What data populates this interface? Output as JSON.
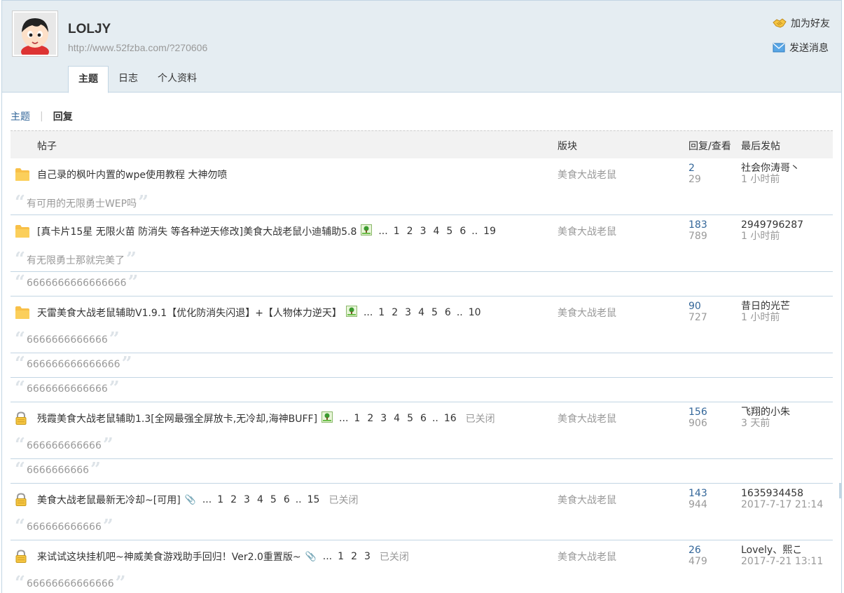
{
  "profile": {
    "username": "LOLJY",
    "url": "http://www.52fzba.com/?270606",
    "add_friend": "加为好友",
    "send_message": "发送消息"
  },
  "tabs": [
    {
      "label": "主题",
      "active": true
    },
    {
      "label": "日志",
      "active": false
    },
    {
      "label": "个人资料",
      "active": false
    }
  ],
  "subnav": {
    "topics": "主题",
    "replies": "回复"
  },
  "table_header": {
    "post": "帖子",
    "forum": "版块",
    "reply_view": "回复/查看",
    "last_post": "最后发帖"
  },
  "threads": [
    {
      "title": "自己录的枫叶内置的wpe使用教程 大神勿喷",
      "icon": "folder-icon",
      "has_image": false,
      "has_attachment": false,
      "pages": [],
      "closed": "",
      "forum": "美食大战老鼠",
      "replies": "2",
      "views": "29",
      "last_user": "社会你涛哥丶",
      "last_time": "1 小时前",
      "quotes": [
        "有可用的无限勇士WEP吗"
      ]
    },
    {
      "title": "[真卡片15星 无限火苗 防消失 等各种逆天修改]美食大战老鼠小迪辅助5.8",
      "icon": "folder-icon",
      "has_image": true,
      "has_attachment": false,
      "pages": [
        "...",
        "1",
        "2",
        "3",
        "4",
        "5",
        "6",
        "..",
        "19"
      ],
      "closed": "",
      "forum": "美食大战老鼠",
      "replies": "183",
      "views": "789",
      "last_user": "2949796287",
      "last_time": "1 小时前",
      "quotes": [
        "有无限勇士那就完美了",
        "6666666666666666"
      ]
    },
    {
      "title": "天雷美食大战老鼠辅助V1.9.1【优化防消失闪退】+【人物体力逆天】",
      "icon": "folder-icon",
      "has_image": true,
      "has_attachment": false,
      "pages": [
        "...",
        "1",
        "2",
        "3",
        "4",
        "5",
        "6",
        "..",
        "10"
      ],
      "closed": "",
      "forum": "美食大战老鼠",
      "replies": "90",
      "views": "727",
      "last_user": "昔日的光芒",
      "last_time": "1 小时前",
      "quotes": [
        "6666666666666",
        "666666666666666",
        "6666666666666"
      ]
    },
    {
      "title": "残霞美食大战老鼠辅助1.3[全网最强全屏放卡,无冷却,海神BUFF]",
      "icon": "lock-icon",
      "has_image": true,
      "has_attachment": false,
      "pages": [
        "...",
        "1",
        "2",
        "3",
        "4",
        "5",
        "6",
        "..",
        "16"
      ],
      "closed": "已关闭",
      "forum": "美食大战老鼠",
      "replies": "156",
      "views": "906",
      "last_user": "飞翔的小朱",
      "last_time": "3 天前",
      "quotes": [
        "666666666666",
        "6666666666"
      ]
    },
    {
      "title": "美食大战老鼠最新无冷却~[可用]",
      "icon": "lock-icon",
      "has_image": false,
      "has_attachment": true,
      "pages": [
        "...",
        "1",
        "2",
        "3",
        "4",
        "5",
        "6",
        "..",
        "15"
      ],
      "closed": "已关闭",
      "forum": "美食大战老鼠",
      "replies": "143",
      "views": "944",
      "last_user": "1635934458",
      "last_time": "2017-7-17 21:14",
      "quotes": [
        "666666666666"
      ]
    },
    {
      "title": "来试试这块挂机吧~神威美食游戏助手回归！Ver2.0重置版~",
      "icon": "lock-icon",
      "has_image": false,
      "has_attachment": true,
      "pages": [
        "...",
        "1",
        "2",
        "3"
      ],
      "closed": "已关闭",
      "forum": "美食大战老鼠",
      "replies": "26",
      "views": "479",
      "last_user": "Lovely、熙こ",
      "last_time": "2017-7-21 13:11",
      "quotes": [
        "66666666666666"
      ]
    }
  ]
}
